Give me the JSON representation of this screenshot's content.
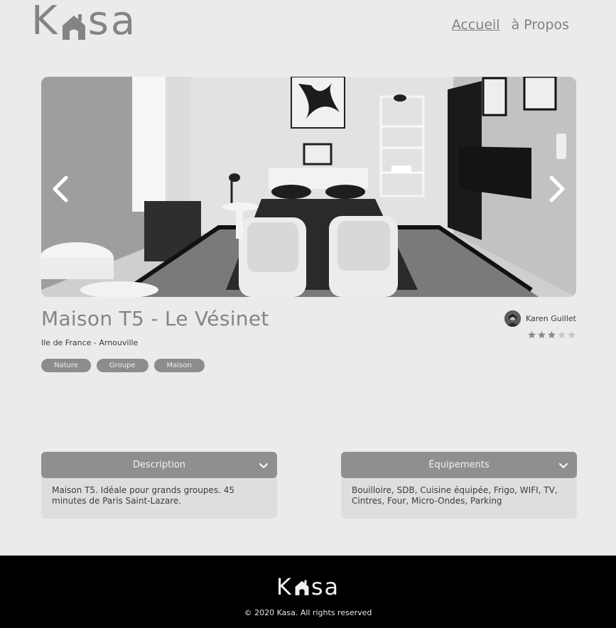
{
  "header": {
    "logo_text_left": "K",
    "logo_text_right": "sa",
    "nav": [
      {
        "label": "Accueil",
        "active": true
      },
      {
        "label": "à Propos",
        "active": false
      }
    ]
  },
  "gallery": {
    "prev_icon": "chevron-left-icon",
    "next_icon": "chevron-right-icon",
    "image_alt": "Apartment interior photo"
  },
  "listing": {
    "title": "Maison T5 - Le Vésinet",
    "location": "Ile de France - Arnouville",
    "tags": [
      "Nature",
      "Groupe",
      "Maison"
    ],
    "host_name": "Karen Guillet",
    "rating": 3,
    "rating_max": 5
  },
  "collapses": [
    {
      "title": "Description",
      "content": "Maison T5. Idéale pour grands groupes. 45 minutes de Paris Saint-Lazare."
    },
    {
      "title": "Équipements",
      "content": "Bouilloire, SDB, Cuisine équipée, Frigo, WIFI, TV, Cintres, Four, Micro-Ondes, Parking"
    }
  ],
  "footer": {
    "logo_text_left": "K",
    "logo_text_right": "sa",
    "copyright": "© 2020 Kasa. All rights reserved"
  },
  "colors": {
    "background": "#ebebeb",
    "accent": "#8f8f8f",
    "footer": "#000000"
  }
}
